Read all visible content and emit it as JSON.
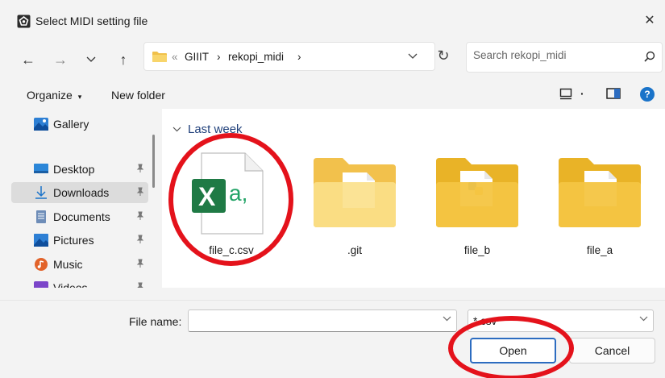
{
  "window": {
    "title": "Select MIDI setting file",
    "close_glyph": "✕"
  },
  "navigation": {
    "back_glyph": "←",
    "forward_glyph": "→",
    "recent_glyph": "⌄",
    "up_glyph": "↑",
    "overflow_glyph": "«",
    "breadcrumb": [
      "GIIIT",
      "rekopi_midi"
    ],
    "separator_glyph": "›",
    "refresh_glyph": "↻",
    "search_placeholder": "Search rekopi_midi"
  },
  "toolbar": {
    "organize_label": "Organize",
    "organize_caret": "▾",
    "new_folder_label": "New folder",
    "view_caret": "·",
    "help_glyph": "?"
  },
  "sidebar": {
    "items": [
      {
        "label": "Gallery",
        "icon": "gallery-icon",
        "pinned": false
      },
      {
        "label": "Desktop",
        "icon": "desktop-icon",
        "pinned": true
      },
      {
        "label": "Downloads",
        "icon": "download-icon",
        "pinned": true,
        "selected": true
      },
      {
        "label": "Documents",
        "icon": "documents-icon",
        "pinned": true
      },
      {
        "label": "Pictures",
        "icon": "pictures-icon",
        "pinned": true
      },
      {
        "label": "Music",
        "icon": "music-icon",
        "pinned": true
      },
      {
        "label": "Videos",
        "icon": "videos-icon",
        "pinned": true
      }
    ]
  },
  "content": {
    "group_label": "Last week",
    "files": [
      {
        "name": "file_c.csv",
        "type": "csv",
        "icon": "excel-csv-icon",
        "badge_letter": "X",
        "badge_suffix": "a,",
        "highlighted": true
      },
      {
        "name": ".git",
        "type": "folder",
        "icon": "folder-icon"
      },
      {
        "name": "file_b",
        "type": "folder",
        "icon": "folder-python-icon"
      },
      {
        "name": "file_a",
        "type": "folder",
        "icon": "folder-icon"
      }
    ]
  },
  "footer": {
    "file_name_label": "File name:",
    "file_name_value": "",
    "file_type_value": "*.csv",
    "open_label": "Open",
    "cancel_label": "Cancel"
  },
  "colors": {
    "annotation_red": "#e4121b",
    "accent_blue": "#2c6cc0",
    "excel_green": "#1f7a45",
    "folder_yellow": "#f4c542"
  }
}
